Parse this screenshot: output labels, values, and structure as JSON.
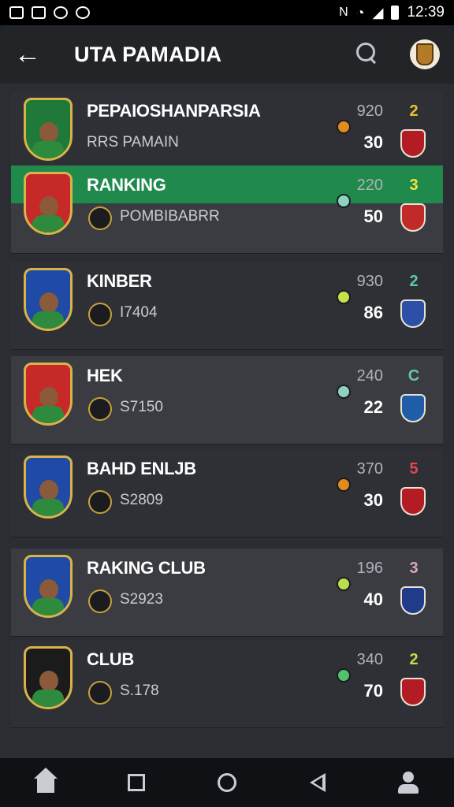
{
  "status_bar": {
    "time": "12:39",
    "left_icons": [
      "app-icon",
      "app-icon",
      "app-icon",
      "app-icon"
    ],
    "right_icons": [
      "nfc-icon",
      "wifi-icon",
      "signal-icon",
      "battery-icon"
    ]
  },
  "header": {
    "title": "UTA PAMADIA",
    "back_icon": "arrow-left-icon",
    "search_icon": "search-icon",
    "profile_icon": "club-crest-icon"
  },
  "rows": [
    {
      "name": "PEPAIOSHANPARSIA",
      "sub": "RRS PAMAIN",
      "score": "920",
      "rank": "2",
      "points": "30",
      "rank_color": "#e6c229",
      "dot_color": "#e38a1e",
      "shield_color": "#1f7a3a",
      "badge_color": "#b31c24"
    },
    {
      "name": "RANKING",
      "sub": "POMBIBABRR",
      "score": "220",
      "rank": "3",
      "points": "50",
      "rank_color": "#f2e245",
      "dot_color": "#8fd1c1",
      "shield_color": "#c72828",
      "badge_color": "#c22a2a"
    },
    {
      "name": "KINBER",
      "sub": "I7404",
      "score": "930",
      "rank": "2",
      "points": "86",
      "rank_color": "#5ec9a7",
      "dot_color": "#c6e04a",
      "shield_color": "#1f4aa5",
      "badge_color": "#2c4fa8"
    },
    {
      "name": "HEK",
      "sub": "S7150",
      "score": "240",
      "rank": "C",
      "points": "22",
      "rank_color": "#5ec9a7",
      "dot_color": "#8fd1c1",
      "shield_color": "#c72828",
      "badge_color": "#1f5da8"
    },
    {
      "name": "BAHD ENLJB",
      "sub": "S2809",
      "score": "370",
      "rank": "5",
      "points": "30",
      "rank_color": "#e0474f",
      "dot_color": "#e38a1e",
      "shield_color": "#1f4aa5",
      "badge_color": "#b31c24"
    },
    {
      "name": "RAKING CLUB",
      "sub": "S2923",
      "score": "196",
      "rank": "3",
      "points": "40",
      "rank_color": "#d8a6b9",
      "dot_color": "#b9e04a",
      "shield_color": "#1f4aa5",
      "badge_color": "#1f3b8a"
    },
    {
      "name": "CLUB",
      "sub": "S.178",
      "score": "340",
      "rank": "2",
      "points": "70",
      "rank_color": "#b9e04a",
      "dot_color": "#4fc26a",
      "shield_color": "#1b1b1b",
      "badge_color": "#b31c24"
    }
  ],
  "nav": [
    "home-icon",
    "recents-icon",
    "circle-home-icon",
    "back-icon",
    "profile-icon"
  ]
}
